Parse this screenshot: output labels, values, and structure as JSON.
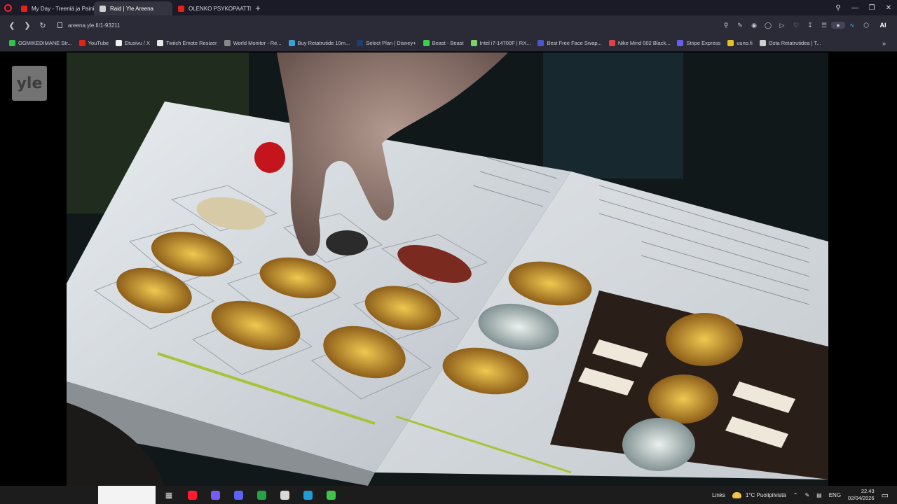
{
  "browser": {
    "tabs": [
      {
        "label": "My Day - Treeniä ja Painiä",
        "favicon_color": "#e62117",
        "active": false
      },
      {
        "label": "Raid | Yle Areena",
        "favicon_color": "#cfcfcf",
        "active": true
      },
      {
        "label": "OLENKO PSYKOPAATTI? Fe",
        "favicon_color": "#e62117",
        "active": false
      }
    ],
    "url": "areena.yle.fi/1-93211",
    "ai_label": "AI"
  },
  "bookmarks": [
    {
      "label": "OGMIKEDIMANE Str...",
      "color": "#35c04b"
    },
    {
      "label": "YouTube",
      "color": "#e62117"
    },
    {
      "label": "Etusivu / X",
      "color": "#f0f0f0"
    },
    {
      "label": "Twitch Emote Resizer",
      "color": "#e8e8e8"
    },
    {
      "label": "World Monitor - Re...",
      "color": "#888888"
    },
    {
      "label": "Buy Retatrutide 10m...",
      "color": "#3aa0d8"
    },
    {
      "label": "Select Plan | Disney+",
      "color": "#1d3f6e"
    },
    {
      "label": "Beast - Beast",
      "color": "#3ecf4a"
    },
    {
      "label": "Intel i7-14700F | RX...",
      "color": "#7bd36b"
    },
    {
      "label": "Best Free Face Swap...",
      "color": "#4b55c9"
    },
    {
      "label": "Nike Mind 002 Black...",
      "color": "#e04040"
    },
    {
      "label": "Stripe Express",
      "color": "#6a5cf0"
    },
    {
      "label": "uuno.fi",
      "color": "#e8c021"
    },
    {
      "label": "Osta Retatrutidea | T...",
      "color": "#cfcfcf"
    }
  ],
  "video": {
    "channel_logo": "yle"
  },
  "taskbar": {
    "links_label": "Links",
    "weather": "1°C  Puolipilvistä",
    "language": "ENG",
    "time": "22.43",
    "date": "02/04/2026",
    "apps": [
      {
        "name": "opera-icon",
        "color": "#ff1b2d"
      },
      {
        "name": "copilot-icon",
        "color": "#7a5af5"
      },
      {
        "name": "discord-icon",
        "color": "#5865f2"
      },
      {
        "name": "whatsapp-desktop-icon",
        "color": "#25a244"
      },
      {
        "name": "shield-app-icon",
        "color": "#d9d9d9"
      },
      {
        "name": "edge-icon",
        "color": "#1f9bd8"
      },
      {
        "name": "play-store-icon",
        "color": "#3fc54a"
      }
    ]
  }
}
